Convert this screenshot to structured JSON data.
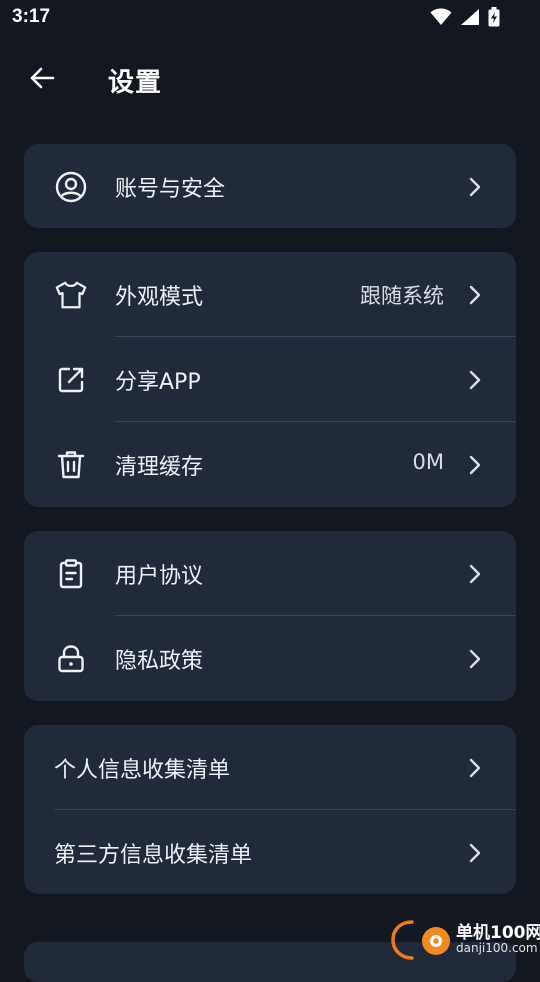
{
  "status_bar": {
    "time": "3:17"
  },
  "header": {
    "title": "设置"
  },
  "groups": [
    {
      "rows": [
        {
          "label": "账号与安全",
          "value": "",
          "icon": "user-circle-icon"
        }
      ]
    },
    {
      "rows": [
        {
          "label": "外观模式",
          "value": "跟随系统",
          "icon": "shirt-icon"
        },
        {
          "label": "分享APP",
          "value": "",
          "icon": "share-external-icon"
        },
        {
          "label": "清理缓存",
          "value": "0M",
          "icon": "trash-icon"
        }
      ]
    },
    {
      "rows": [
        {
          "label": "用户协议",
          "value": "",
          "icon": "clipboard-icon"
        },
        {
          "label": "隐私政策",
          "value": "",
          "icon": "lock-icon"
        }
      ]
    },
    {
      "rows": [
        {
          "label": "个人信息收集清单",
          "value": ""
        },
        {
          "label": "第三方信息收集清单",
          "value": ""
        }
      ]
    }
  ],
  "watermark": {
    "name": "单机100网",
    "url": "danji100.com"
  },
  "colors": {
    "background": "#13171f",
    "card": "#212a3a",
    "divider": "#3a4456",
    "text": "#eef1f6"
  }
}
